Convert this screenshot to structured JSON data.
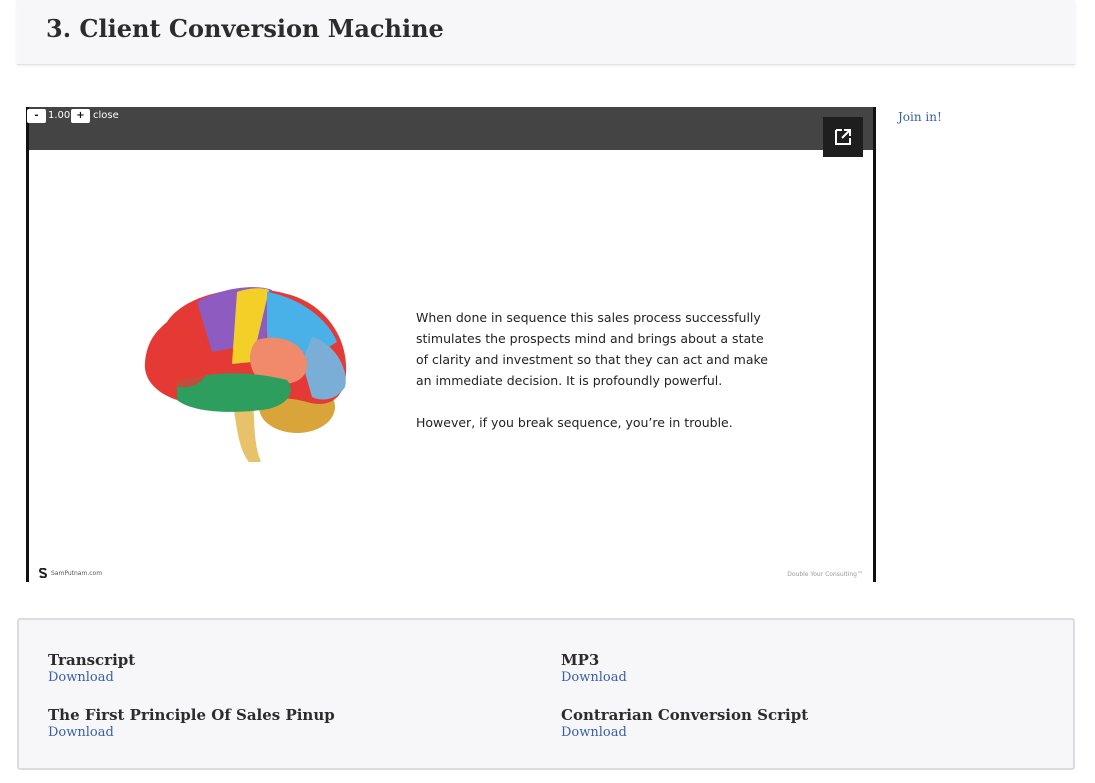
{
  "header": {
    "title": "3. Client Conversion Machine"
  },
  "player": {
    "controls": {
      "minus_label": "-",
      "zoom_value": "1.00",
      "plus_label": "+",
      "close_label": "close"
    },
    "slide": {
      "paragraph1": "When done in sequence this sales process successfully stimulates the prospects mind and brings about a state of clarity and investment so that they can act and make an immediate decision. It is profoundly powerful.",
      "paragraph2": "However, if you break sequence, you’re in trouble.",
      "footer_left": "SamPutnam.com",
      "footer_right": "Double Your Consulting™"
    },
    "icons": {
      "expand": "open-in-new-icon",
      "brand_logo": "s-logo-icon",
      "slide_image": "brain-illustration"
    }
  },
  "sidebar": {
    "join_label": "Join in!"
  },
  "downloads": {
    "items": [
      {
        "title": "Transcript",
        "link": "Download"
      },
      {
        "title": "MP3",
        "link": "Download"
      },
      {
        "title": "The First Principle Of Sales Pinup",
        "link": "Download"
      },
      {
        "title": "Contrarian Conversion Script",
        "link": "Download"
      }
    ]
  }
}
